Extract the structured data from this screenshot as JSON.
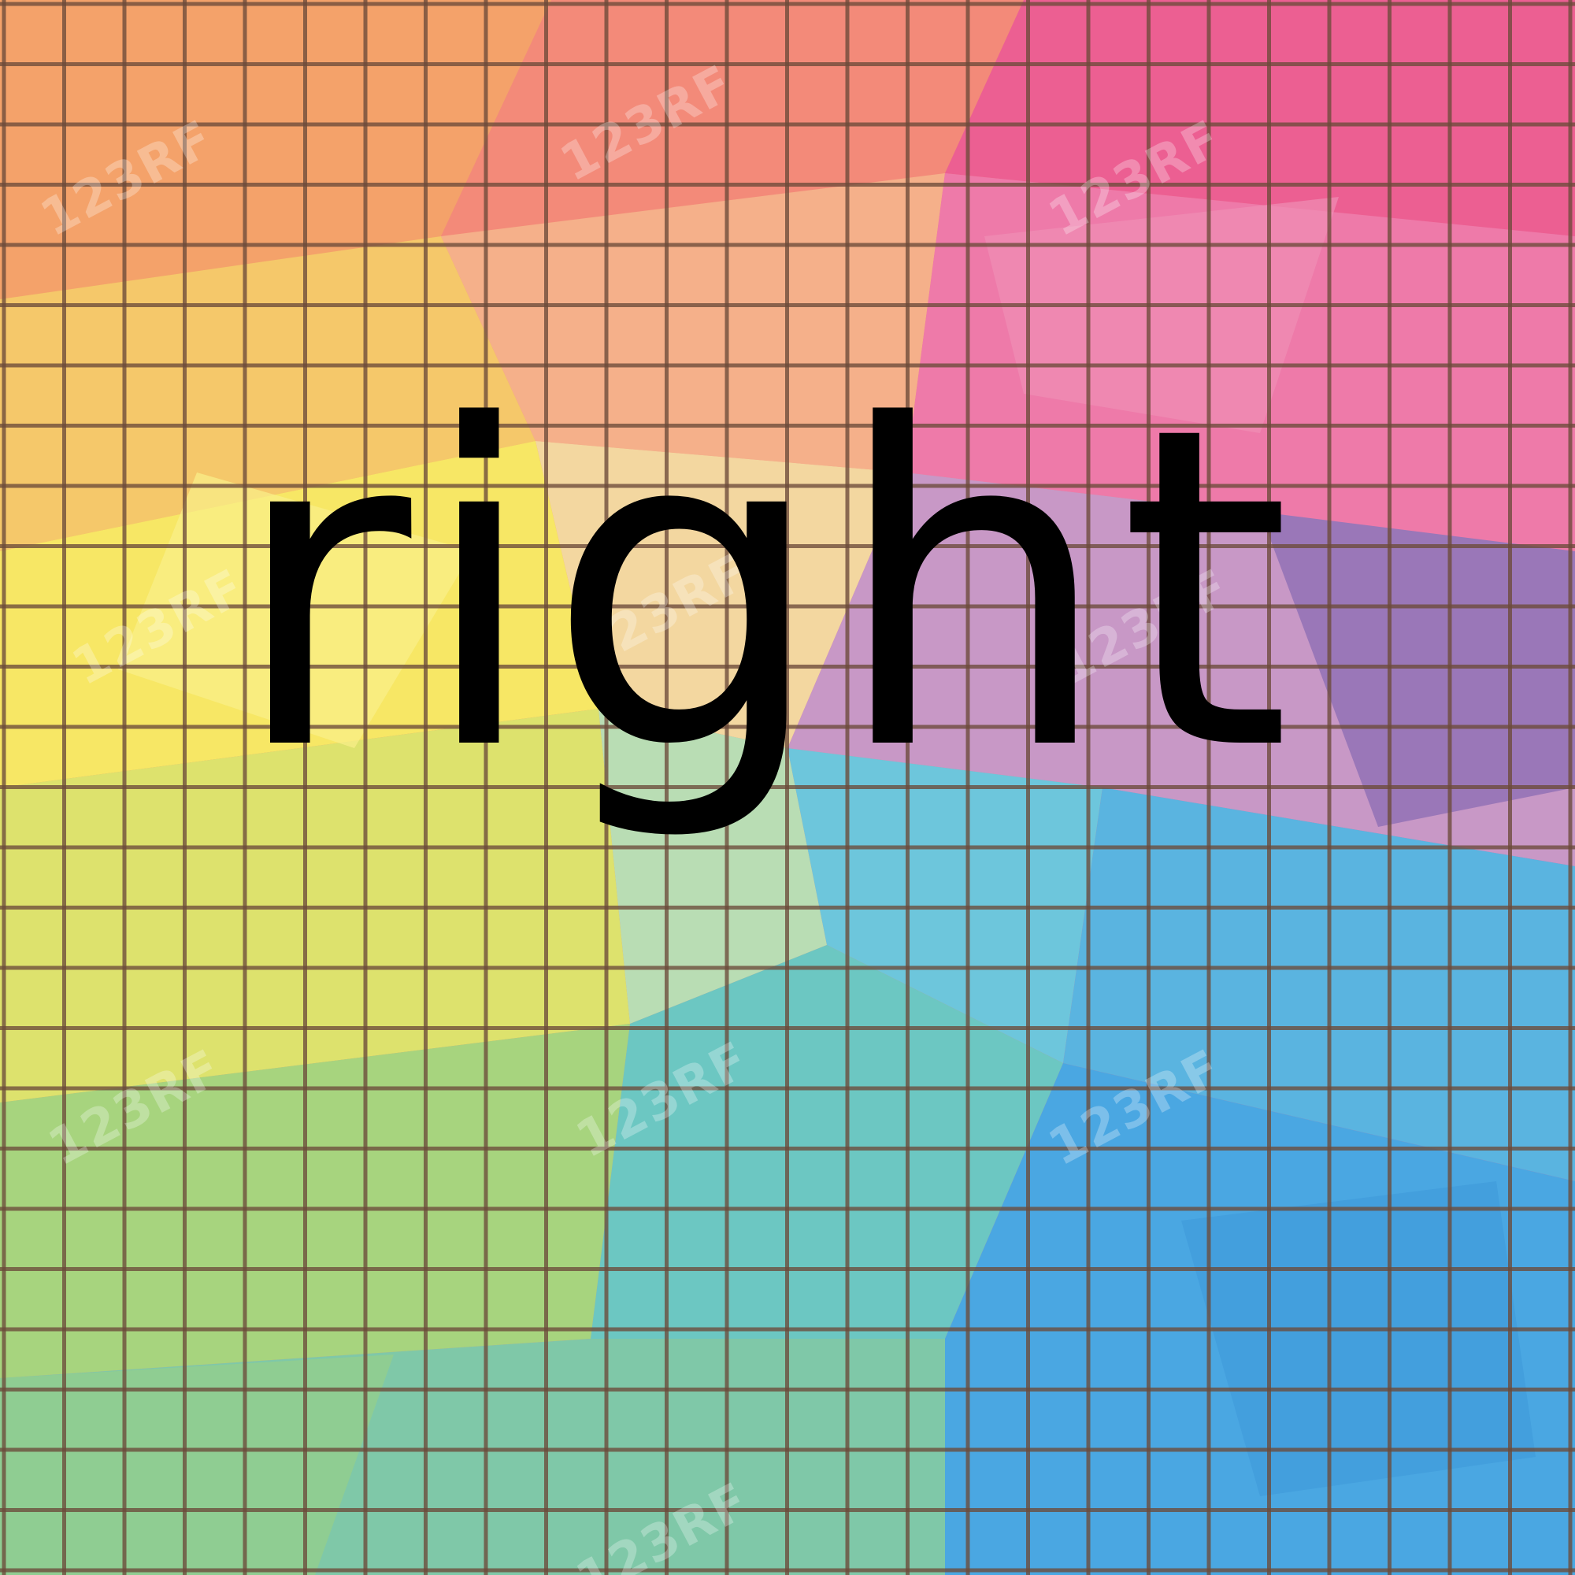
{
  "word": "right",
  "watermark_text": "123RF",
  "colors": {
    "text": "#000000",
    "grid_line": "#6b4a3a",
    "orange": "#f2a66e",
    "pink": "#ee6fa5",
    "yellow": "#f7ec63",
    "green": "#9fd080",
    "cyan": "#55c3de",
    "blue": "#4aa6e2",
    "purple": "#9a77b8"
  }
}
